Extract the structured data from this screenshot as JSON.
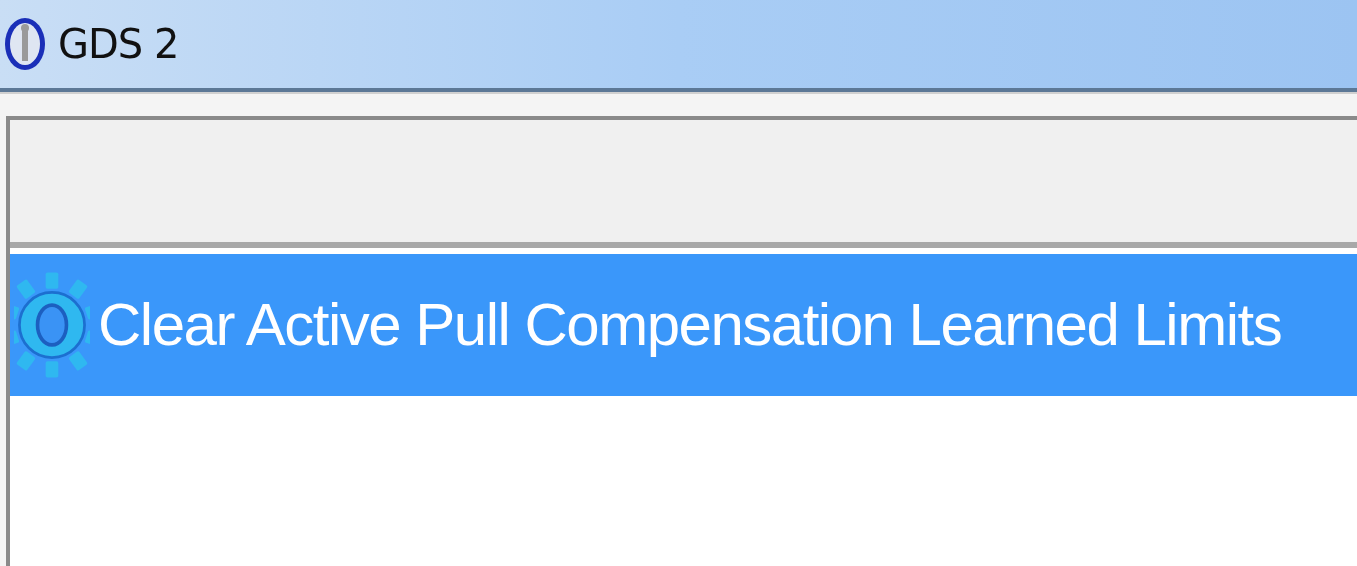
{
  "window": {
    "title": "GDS 2"
  },
  "list": {
    "items": [
      {
        "label": "Clear Active Pull Compensation Learned Limits",
        "selected": true
      }
    ]
  }
}
